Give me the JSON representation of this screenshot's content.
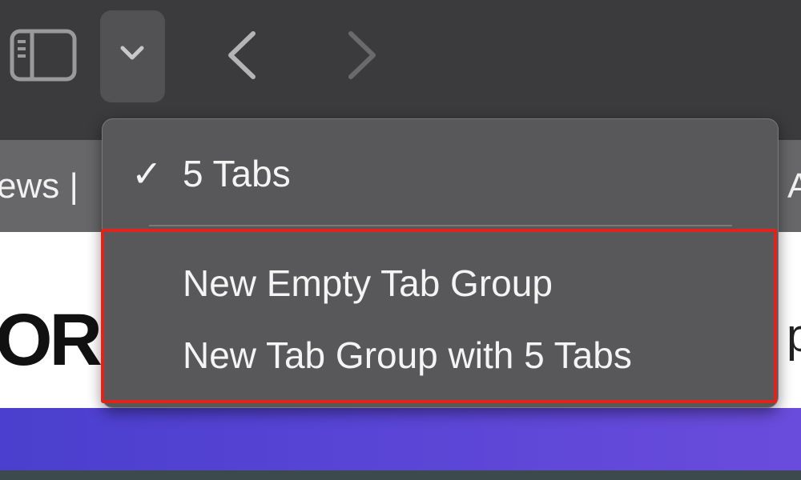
{
  "toolbar": {
    "sidebar_icon": "sidebar-icon",
    "tab_group_chevron_icon": "chevron-down-icon",
    "back_icon": "chevron-left-icon",
    "forward_icon": "chevron-right-icon"
  },
  "tabbar": {
    "left_tab_fragment": "ews | ",
    "right_tab_fragment": "A"
  },
  "page": {
    "left_heading_fragment": "ORO",
    "right_text_fragment": "p"
  },
  "menu": {
    "checkmark": "✓",
    "current_group": "5 Tabs",
    "items": [
      {
        "label": "New Empty Tab Group"
      },
      {
        "label": "New Tab Group with 5 Tabs"
      }
    ]
  },
  "colors": {
    "toolbar": "#3b3b3d",
    "tabbar": "#676769",
    "menu_bg": "#58585a",
    "highlight": "#e0241b",
    "banner": "#5a45d6"
  }
}
